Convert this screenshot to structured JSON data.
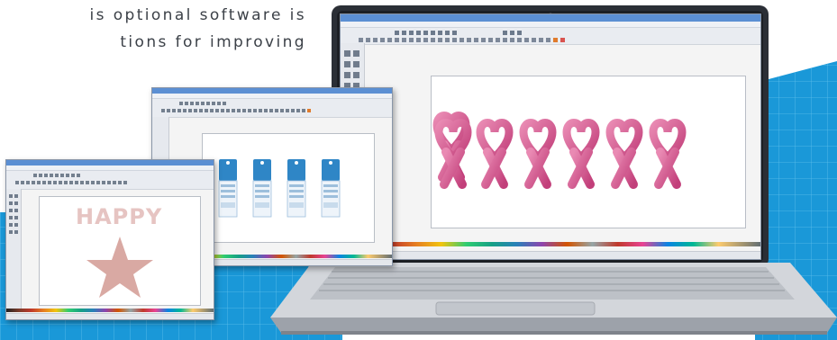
{
  "promo": {
    "line1": "is optional software is",
    "line2": "tions for improving"
  },
  "windows": {
    "back_left": {
      "design_text": "HAPPY"
    }
  },
  "colors": {
    "accent_blue": "#1e9ad6",
    "ribbon_pink": "#d14f8a",
    "star_pink": "#d9a9a3",
    "tag_blue": "#2f86c6",
    "laptop_silver": "#c9ccd1"
  }
}
